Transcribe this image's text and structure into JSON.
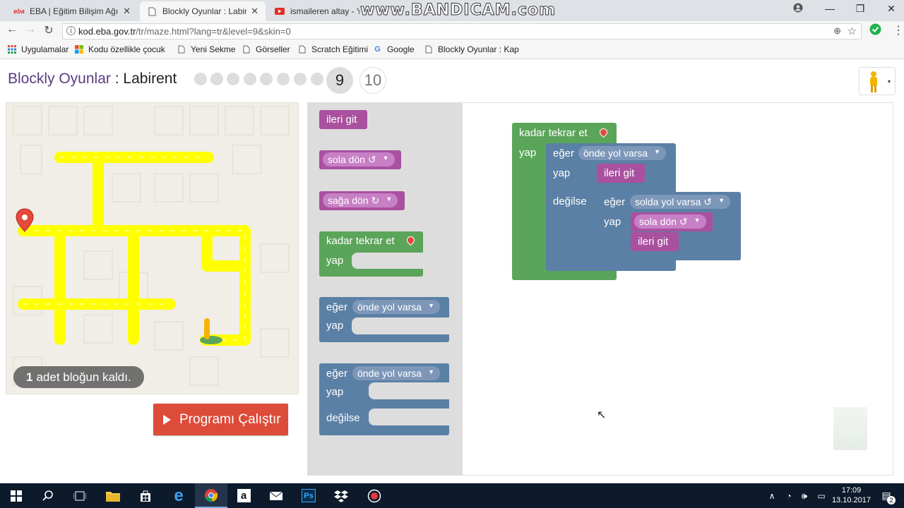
{
  "browser": {
    "tabs": [
      {
        "title": "EBA | Eğitim Bilişim Ağı",
        "favicon": "eba-logo",
        "active": false
      },
      {
        "title": "Blockly Oyunlar : Labirent",
        "favicon": "page-icon",
        "active": true
      },
      {
        "title": "ismaileren altay - YouTube",
        "favicon": "youtube-icon",
        "active": false
      }
    ],
    "watermark": "www.BANDICAM.com",
    "url_host": "kod.eba.gov.tr",
    "url_path": "/tr/maze.html?lang=tr&level=9&skin=0",
    "bookmarks": [
      {
        "label": "Uygulamalar",
        "icon": "apps-grid-icon"
      },
      {
        "label": "Kodu özellikle çocukl",
        "icon": "windows-icon"
      },
      {
        "label": "Yeni Sekme",
        "icon": "page-icon"
      },
      {
        "label": "Görseller",
        "icon": "page-icon"
      },
      {
        "label": "Scratch Eğitimi",
        "icon": "page-icon"
      },
      {
        "label": "Google",
        "icon": "google-icon"
      },
      {
        "label": "Blockly Oyunlar : Kap",
        "icon": "page-icon"
      }
    ]
  },
  "page": {
    "app_name": "Blockly Oyunlar",
    "separator": " : ",
    "game_name": "Labirent",
    "levels": [
      "9",
      "10"
    ],
    "current_level": "9",
    "remaining_count": "1",
    "remaining_text": "adet bloğun kaldı.",
    "run_button": "Programı Çalıştır"
  },
  "toolbox": {
    "move_forward": "ileri git",
    "turn_left": "sola dön ↺",
    "turn_right": "sağa dön ↻",
    "repeat_until": "kadar tekrar et",
    "do": "yap",
    "if": "eğer",
    "path_ahead": "önde yol varsa",
    "else": "değilse"
  },
  "program": {
    "repeat_until": "kadar tekrar et",
    "do": "yap",
    "if": "eğer",
    "path_ahead": "önde yol varsa",
    "move_forward": "ileri git",
    "else": "değilse",
    "path_left": "solda yol varsa ↺",
    "turn_left": "sola dön ↺",
    "move_forward_2": "ileri git"
  },
  "taskbar": {
    "time": "17:09",
    "date": "13.10.2017",
    "notification_count": "2"
  },
  "colors": {
    "logic_block": "#5b80a5",
    "loop_block": "#5ba55b",
    "movement_block": "#a9509f",
    "maze_path": "#ffff00",
    "run_button": "#dd4b39"
  }
}
